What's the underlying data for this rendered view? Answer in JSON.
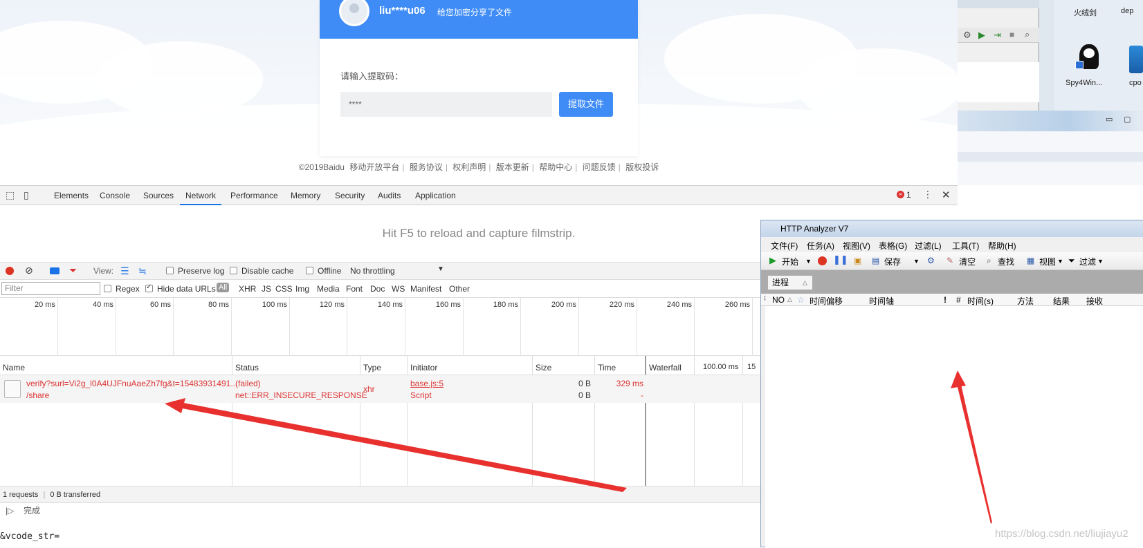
{
  "share": {
    "user": "liu****u06",
    "message": "给您加密分享了文件",
    "code_label": "请输入提取码：",
    "code_value": "****",
    "extract_button": "提取文件"
  },
  "footer": {
    "copyright": "©2019Baidu",
    "links": [
      "移动开放平台",
      "服务协议",
      "权利声明",
      "版本更新",
      "帮助中心",
      "问题反馈",
      "版权投诉"
    ]
  },
  "desktop": {
    "icon1_label": "火绒剑",
    "icon2_label": "dep",
    "icon3_label": "Spy4Win...",
    "icon4_label": "cpo"
  },
  "devtools": {
    "tabs": [
      "Elements",
      "Console",
      "Sources",
      "Network",
      "Performance",
      "Memory",
      "Security",
      "Audits",
      "Application"
    ],
    "active_tab": "Network",
    "error_count": "1",
    "filmstrip_hint": "Hit F5 to reload and capture filmstrip.",
    "toolbar": {
      "view_label": "View:",
      "preserve_log": "Preserve log",
      "disable_cache": "Disable cache",
      "offline": "Offline",
      "throttling": "No throttling"
    },
    "filter": {
      "placeholder": "Filter",
      "regex": "Regex",
      "hide_data_urls": "Hide data URLs",
      "types": [
        "All",
        "XHR",
        "JS",
        "CSS",
        "Img",
        "Media",
        "Font",
        "Doc",
        "WS",
        "Manifest",
        "Other"
      ]
    },
    "timeline_ticks": [
      "20 ms",
      "40 ms",
      "60 ms",
      "80 ms",
      "100 ms",
      "120 ms",
      "140 ms",
      "160 ms",
      "180 ms",
      "200 ms",
      "220 ms",
      "240 ms",
      "260 ms"
    ],
    "columns": {
      "name": "Name",
      "status": "Status",
      "type": "Type",
      "initiator": "Initiator",
      "size": "Size",
      "time": "Time",
      "waterfall": "Waterfall",
      "waterfall_scale": "100.00 ms",
      "waterfall_scale2": "15"
    },
    "request": {
      "name": "verify?surl=Vi2g_l0A4UJFnuAaeZh7fg&t=15483931491...",
      "path": "/share",
      "status": "(failed)",
      "status_detail": "net::ERR_INSECURE_RESPONSE",
      "type": "xhr",
      "initiator": "base.js:5",
      "initiator_type": "Script",
      "size1": "0 B",
      "size2": "0 B",
      "time1": "329 ms",
      "time2": "-"
    },
    "summary_requests": "1 requests",
    "summary_transferred": "0 B transferred",
    "console_status": "完成"
  },
  "bottom_text": "&vcode_str=",
  "analyzer": {
    "title": "HTTP Analyzer V7",
    "menu": [
      "文件(F)",
      "任务(A)",
      "视图(V)",
      "表格(G)",
      "过滤(L)",
      "工具(T)",
      "帮助(H)"
    ],
    "toolbar": {
      "start": "开始",
      "save": "保存",
      "clear": "清空",
      "find": "查找",
      "view": "视图",
      "filter": "过滤"
    },
    "sub_tab": "进程",
    "columns": [
      "NO",
      "时间偏移",
      "时间轴",
      "!",
      "#",
      "时间(s)",
      "方法",
      "结果",
      "接收"
    ]
  },
  "watermark": "https://blog.csdn.net/liujiayu2",
  "colors": {
    "accent_blue": "#3f8cf6",
    "error_red": "#d33333",
    "annotation_arrow": "#e8312f"
  }
}
